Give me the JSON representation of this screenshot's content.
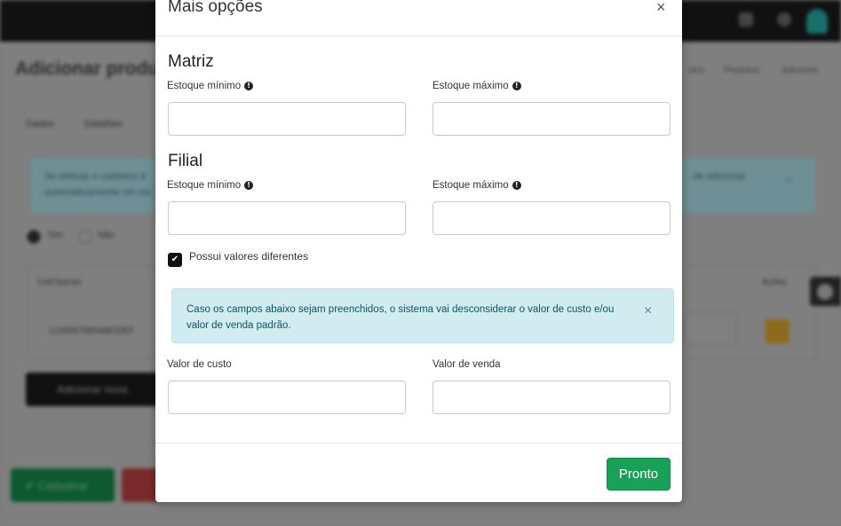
{
  "background": {
    "page_title": "Adicionar produ",
    "breadcrumb": [
      "ulos",
      "Produtos",
      "Adicionar"
    ],
    "tabs": [
      "Dados",
      "Detalhes"
    ],
    "alert_text_line1": "Ao efetuar o cadastro d",
    "alert_text_line2": "automaticamente um códi",
    "alert_text_right": "de adicionar",
    "radio_options": [
      "Sim",
      "Não"
    ],
    "table_headers": [
      "Cód barras",
      "Ações"
    ],
    "table_cell": "1234567890ABCDEF",
    "add_button_label": "Adicionar nova",
    "save_button_label": "Cadastrar"
  },
  "modal": {
    "title": "Mais opções",
    "close_glyph": "×",
    "sections": [
      {
        "title": "Matriz",
        "min_label": "Estoque mínimo",
        "max_label": "Estoque máximo",
        "min_value": "",
        "max_value": ""
      },
      {
        "title": "Filial",
        "min_label": "Estoque mínimo",
        "max_label": "Estoque máximo",
        "min_value": "",
        "max_value": ""
      }
    ],
    "checkbox_label": "Possui valores diferentes",
    "checkbox_checked": true,
    "alert_text": "Caso os campos abaixo sejam preenchidos, o sistema vai desconsiderar o valor de custo e/ou valor de venda padrão.",
    "alert_close": "×",
    "cost_label": "Valor de custo",
    "sale_label": "Valor de venda",
    "cost_value": "",
    "sale_value": "",
    "done_button": "Pronto"
  },
  "colors": {
    "primary_green": "#18a157",
    "alert_bg": "#d1ecf1",
    "alert_text": "#0c5460"
  }
}
